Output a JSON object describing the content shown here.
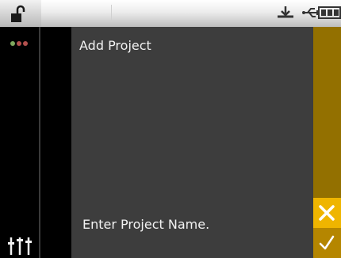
{
  "main": {
    "title": "Add Project",
    "prompt": "Enter Project Name."
  },
  "icons": {
    "lock": "unlocked-padlock-icon",
    "download": "download-icon",
    "usb": "usb-icon",
    "battery": "battery-icon",
    "sliders": "sliders-icon",
    "cancel": "close-icon",
    "confirm": "checkmark-icon"
  },
  "status_dots": [
    "#7fa85e",
    "#b2504d",
    "#b2504d"
  ],
  "colors": {
    "panel_bg": "#3d3d3d",
    "action_bar": "#937000",
    "cancel_bg": "#efb500",
    "confirm_bg": "#b58600",
    "text": "#f2f2f2"
  }
}
